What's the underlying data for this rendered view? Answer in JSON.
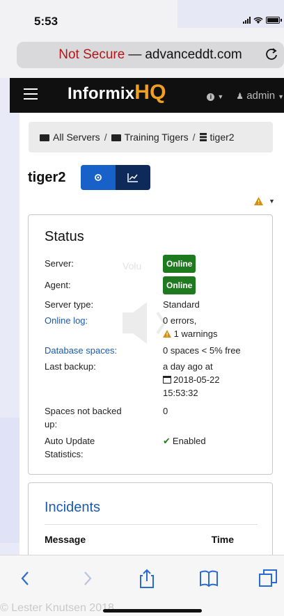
{
  "status_bar": {
    "time": "5:53"
  },
  "browser": {
    "security_label": "Not Secure",
    "separator": "—",
    "domain": "advanceddt.com"
  },
  "navbar": {
    "brand_main": "Informix",
    "brand_suffix": "HQ",
    "user": "admin"
  },
  "breadcrumb": {
    "items": [
      "All Servers",
      "Training Tigers",
      "tiger2"
    ],
    "separator": "/"
  },
  "page": {
    "title": "tiger2"
  },
  "status_panel": {
    "title": "Status",
    "watermark": "Volu",
    "rows": [
      {
        "label": "Server:",
        "value": "Online"
      },
      {
        "label": "Agent:",
        "value": "Online"
      },
      {
        "label": "Server type:",
        "value": "Standard"
      },
      {
        "label": "Online log:",
        "value": "0 errors,",
        "extra": "1 warnings"
      },
      {
        "label": "Database spaces:",
        "value": "0 spaces < 5% free"
      },
      {
        "label": "Last backup:",
        "value": "a day ago at",
        "extra": "2018-05-22",
        "extra2": "15:53:32"
      },
      {
        "label_line1": "Spaces not backed",
        "label_line2": "up:",
        "value": "0"
      },
      {
        "label_line1": "Auto Update",
        "label_line2": "Statistics:",
        "value": "Enabled"
      }
    ]
  },
  "incidents_panel": {
    "title": "Incidents",
    "columns": [
      "Message",
      "Time"
    ]
  },
  "watermark_text": "© Lester Knutsen 2018",
  "colors": {
    "nav_bg": "#101010",
    "brand_accent": "#f0a020",
    "primary": "#1861c8",
    "online": "#1f7a1f",
    "insecure": "#b01818",
    "link": "#1a5bb0"
  }
}
